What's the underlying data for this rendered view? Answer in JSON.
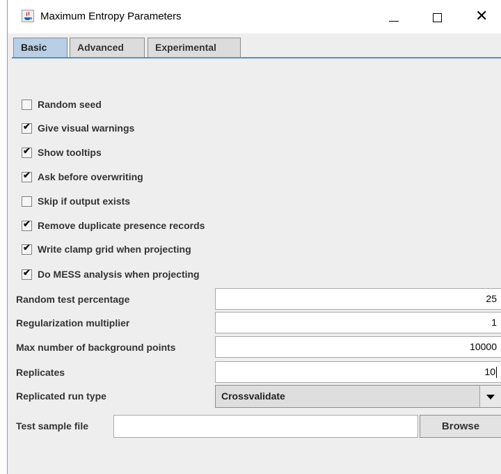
{
  "window": {
    "title": "Maximum Entropy Parameters",
    "controls": {
      "minimize": "–",
      "maximize": "☐",
      "close": "✕"
    }
  },
  "tabs": [
    {
      "label": "Basic",
      "active": true
    },
    {
      "label": "Advanced",
      "active": false
    },
    {
      "label": "Experimental",
      "active": false
    }
  ],
  "checkboxes": [
    {
      "label": "Random seed",
      "checked": false
    },
    {
      "label": "Give visual warnings",
      "checked": true
    },
    {
      "label": "Show tooltips",
      "checked": true
    },
    {
      "label": "Ask before overwriting",
      "checked": true
    },
    {
      "label": "Skip if output exists",
      "checked": false
    },
    {
      "label": "Remove duplicate presence records",
      "checked": true
    },
    {
      "label": "Write clamp grid when projecting",
      "checked": true
    },
    {
      "label": "Do MESS analysis when projecting",
      "checked": true
    }
  ],
  "fields": [
    {
      "label": "Random test percentage",
      "value": "25"
    },
    {
      "label": "Regularization multiplier",
      "value": "1"
    },
    {
      "label": "Max number of background points",
      "value": "10000"
    },
    {
      "label": "Replicates",
      "value": "10"
    }
  ],
  "run_type": {
    "label": "Replicated run type",
    "selected": "Crossvalidate"
  },
  "sample_file": {
    "label": "Test sample file",
    "value": "",
    "browse_label": "Browse"
  },
  "colors": {
    "tab_active": "#b8cfe5",
    "accent_line": "#4f8fd6",
    "panel": "#eeeeee"
  }
}
